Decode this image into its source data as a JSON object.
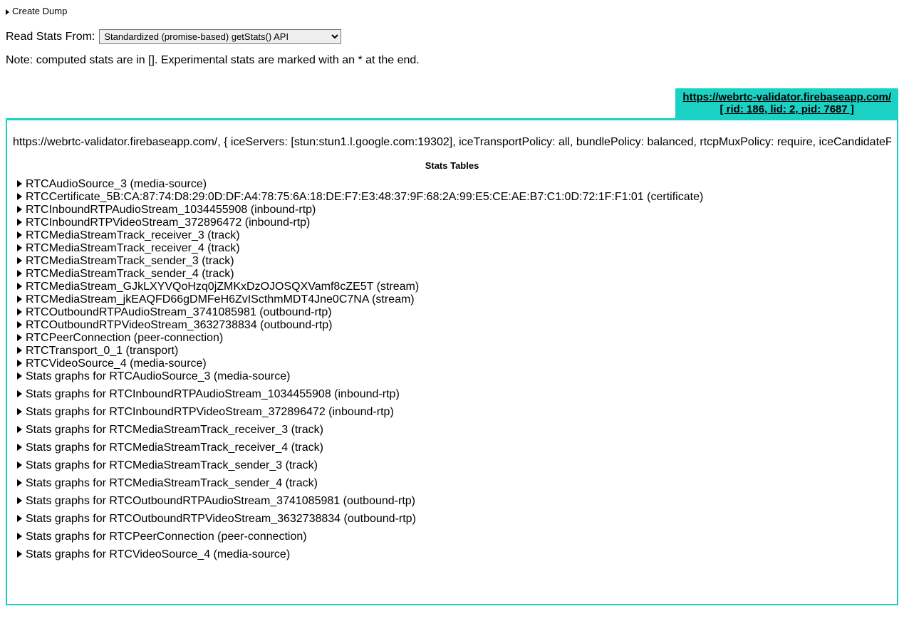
{
  "createDump": {
    "label": "Create Dump"
  },
  "readStats": {
    "label": "Read Stats From:",
    "selected": "Standardized (promise-based) getStats() API"
  },
  "note": "Note: computed stats are in []. Experimental stats are marked with an * at the end.",
  "tab": {
    "url": "https://webrtc-validator.firebaseapp.com/",
    "ids": "[ rid: 186, lid: 2, pid: 7687 ]"
  },
  "panel": {
    "configLine": "https://webrtc-validator.firebaseapp.com/, { iceServers: [stun:stun1.l.google.com:19302], iceTransportPolicy: all, bundlePolicy: balanced, rtcpMuxPolicy: require, iceCandidatePoo",
    "heading": "Stats Tables",
    "items": [
      {
        "label": "RTCAudioSource_3 (media-source)",
        "spaced": false
      },
      {
        "label": "RTCCertificate_5B:CA:87:74:D8:29:0D:DF:A4:78:75:6A:18:DE:F7:E3:48:37:9F:68:2A:99:E5:CE:AE:B7:C1:0D:72:1F:F1:01 (certificate)",
        "spaced": false
      },
      {
        "label": "RTCInboundRTPAudioStream_1034455908 (inbound-rtp)",
        "spaced": false
      },
      {
        "label": "RTCInboundRTPVideoStream_372896472 (inbound-rtp)",
        "spaced": false
      },
      {
        "label": "RTCMediaStreamTrack_receiver_3 (track)",
        "spaced": false
      },
      {
        "label": "RTCMediaStreamTrack_receiver_4 (track)",
        "spaced": false
      },
      {
        "label": "RTCMediaStreamTrack_sender_3 (track)",
        "spaced": false
      },
      {
        "label": "RTCMediaStreamTrack_sender_4 (track)",
        "spaced": false
      },
      {
        "label": "RTCMediaStream_GJkLXYVQoHzq0jZMKxDzOJOSQXVamf8cZE5T (stream)",
        "spaced": false
      },
      {
        "label": "RTCMediaStream_jkEAQFD66gDMFeH6ZvIScthmMDT4Jne0C7NA (stream)",
        "spaced": false
      },
      {
        "label": "RTCOutboundRTPAudioStream_3741085981 (outbound-rtp)",
        "spaced": false
      },
      {
        "label": "RTCOutboundRTPVideoStream_3632738834 (outbound-rtp)",
        "spaced": false
      },
      {
        "label": "RTCPeerConnection (peer-connection)",
        "spaced": false
      },
      {
        "label": "RTCTransport_0_1 (transport)",
        "spaced": false
      },
      {
        "label": "RTCVideoSource_4 (media-source)",
        "spaced": false
      },
      {
        "label": "Stats graphs for RTCAudioSource_3 (media-source)",
        "spaced": false
      },
      {
        "label": "Stats graphs for RTCInboundRTPAudioStream_1034455908 (inbound-rtp)",
        "spaced": true
      },
      {
        "label": "Stats graphs for RTCInboundRTPVideoStream_372896472 (inbound-rtp)",
        "spaced": true
      },
      {
        "label": "Stats graphs for RTCMediaStreamTrack_receiver_3 (track)",
        "spaced": true
      },
      {
        "label": "Stats graphs for RTCMediaStreamTrack_receiver_4 (track)",
        "spaced": true
      },
      {
        "label": "Stats graphs for RTCMediaStreamTrack_sender_3 (track)",
        "spaced": true
      },
      {
        "label": "Stats graphs for RTCMediaStreamTrack_sender_4 (track)",
        "spaced": true
      },
      {
        "label": "Stats graphs for RTCOutboundRTPAudioStream_3741085981 (outbound-rtp)",
        "spaced": true
      },
      {
        "label": "Stats graphs for RTCOutboundRTPVideoStream_3632738834 (outbound-rtp)",
        "spaced": true
      },
      {
        "label": "Stats graphs for RTCPeerConnection (peer-connection)",
        "spaced": true
      },
      {
        "label": "Stats graphs for RTCVideoSource_4 (media-source)",
        "spaced": true
      }
    ]
  }
}
